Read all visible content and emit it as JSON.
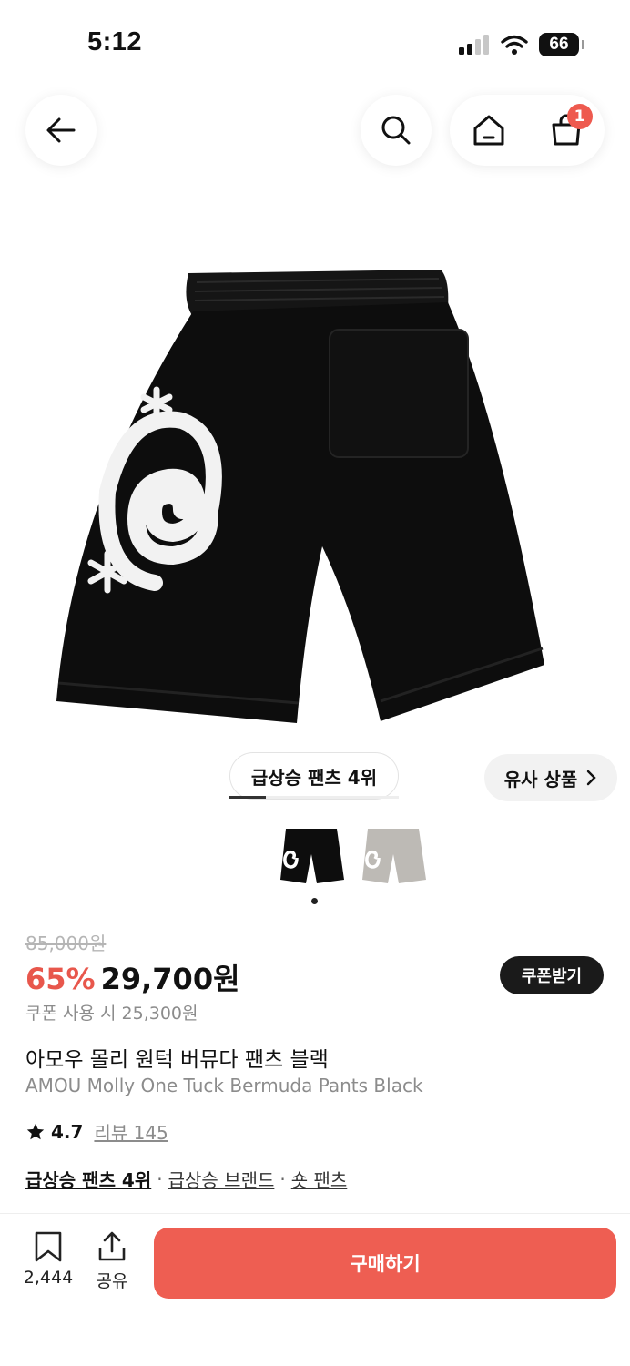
{
  "status_bar": {
    "time": "5:12",
    "battery": "66"
  },
  "nav": {
    "cart_count": "1"
  },
  "rank_badge": "급상승 팬츠 4위",
  "similar_button": "유사 상품",
  "price": {
    "original": "85,000원",
    "discount": "65%",
    "final": "29,700원",
    "coupon_button": "쿠폰받기",
    "coupon_price": "쿠폰 사용 시 25,300원"
  },
  "product": {
    "title_ko": "아모우 몰리 원턱 버뮤다 팬츠 블랙",
    "title_en": "AMOU Molly One Tuck Bermuda Pants Black",
    "rating": "4.7",
    "review_label": "리뷰 145"
  },
  "tags": [
    {
      "label": "급상승 팬츠 4위"
    },
    {
      "label": "급상승 브랜드"
    },
    {
      "label": "숏 팬츠"
    }
  ],
  "bottom_bar": {
    "like_count": "2,444",
    "share_label": "공유",
    "buy_label": "구매하기"
  },
  "colors": {
    "accent": "#ee5e52",
    "discount": "#e8574c"
  },
  "icons": [
    "back-arrow-icon",
    "search-icon",
    "home-icon",
    "cart-icon",
    "chevron-right-icon",
    "star-icon",
    "bookmark-icon",
    "share-icon"
  ]
}
